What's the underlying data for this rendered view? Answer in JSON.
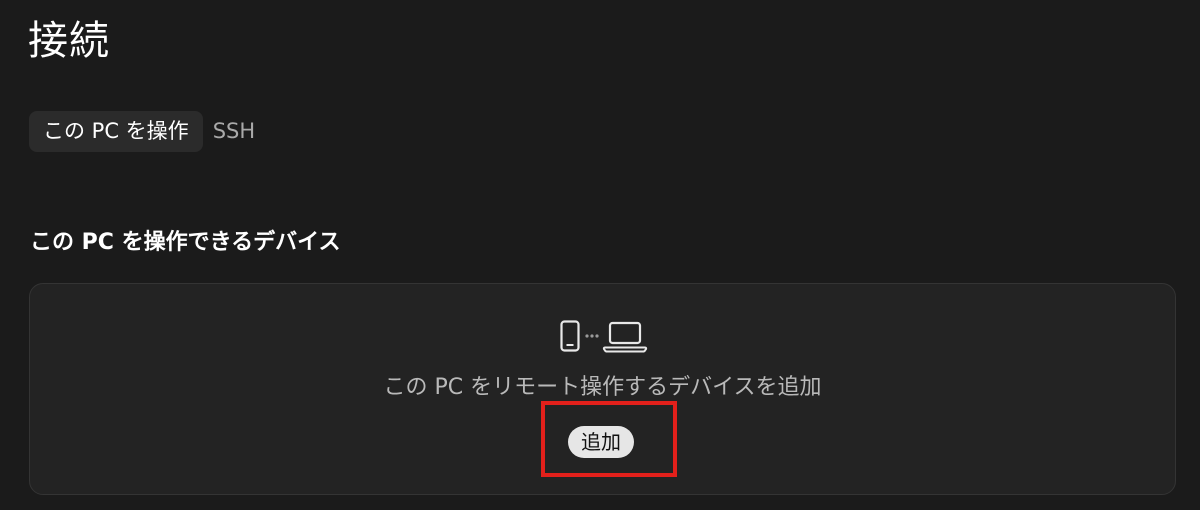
{
  "page": {
    "title": "接続"
  },
  "tabs": [
    {
      "label": "この PC を操作",
      "active": true
    },
    {
      "label": "SSH",
      "active": false
    }
  ],
  "section": {
    "heading": "この PC を操作できるデバイス"
  },
  "card": {
    "icon": "phone-to-laptop-icon",
    "message": "この PC をリモート操作するデバイスを追加",
    "add_button_label": "追加"
  },
  "annotation": {
    "highlight_color": "#e3201b",
    "highlight_target": "add-button"
  },
  "colors": {
    "background": "#1b1b1b",
    "card_background": "#232323",
    "active_tab_background": "#2b2b2b",
    "button_background": "#e6e6e6"
  }
}
